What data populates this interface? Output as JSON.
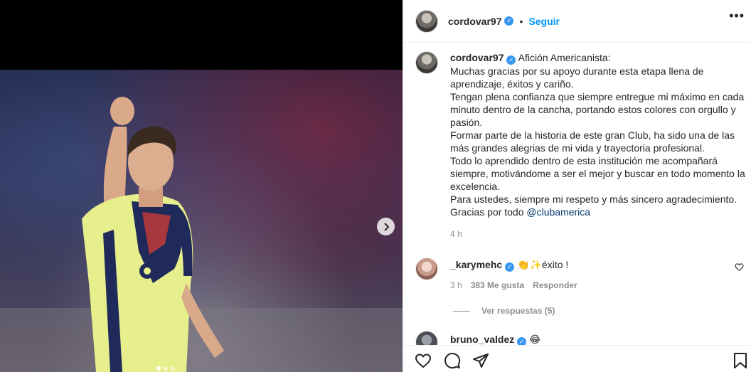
{
  "post": {
    "username": "cordovar97",
    "follow_label": "Seguir",
    "more_label": "•••",
    "caption_title": "Afición Americanista:",
    "caption_text": "Muchas gracias por su apoyo durante esta etapa llena de aprendizaje, éxitos y cariño.\nTengan plena confianza que siempre entregue mi máximo en cada minuto dentro de la cancha, portando estos colores con orgullo y pasión.\nFormar parte de la historia de este gran Club, ha sido una de las más grandes alegrias de mi vida y trayectoria profesional.\nTodo lo aprendido dentro de esta institución me acompañará siempre, motivándome a ser el mejor y buscar en todo momento la excelencia.\nPara ustedes, siempre mi respeto y más sincero agradecimiento.\nGracias por todo ",
    "caption_mention": "@clubamerica",
    "time_ago": "4 h"
  },
  "comments": [
    {
      "username": "_karymehc",
      "text": "👏✨éxito !",
      "time": "3 h",
      "likes": "383 Me gusta",
      "reply_label": "Responder",
      "view_replies": "Ver respuestas (5)"
    },
    {
      "username": "bruno_valdez",
      "text": "😂"
    }
  ],
  "colors": {
    "accent": "#0095f6",
    "verified": "#3897f0",
    "muted": "#8e8e8e",
    "jersey": "#e7ee8c",
    "jersey_navy": "#1f2a5a"
  },
  "icons": {
    "next": "chevron-right-icon",
    "verified": "verified-badge-icon",
    "like": "heart-icon",
    "comment": "comment-icon",
    "share": "share-icon",
    "save": "bookmark-icon"
  }
}
